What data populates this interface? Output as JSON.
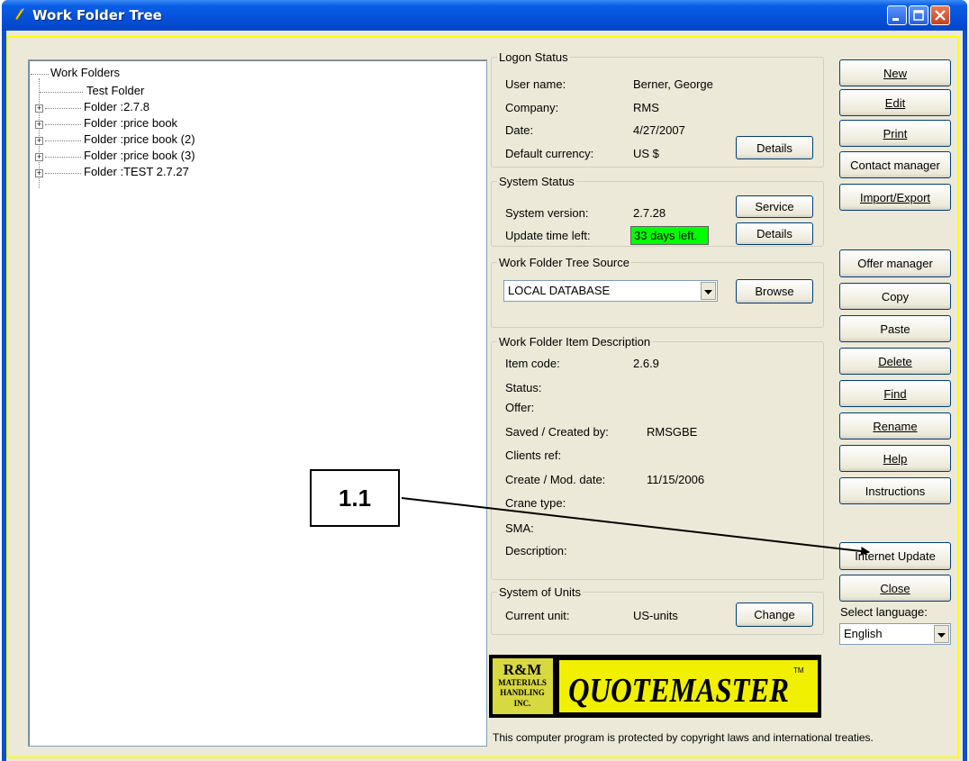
{
  "window": {
    "title": "Work Folder Tree"
  },
  "tree": {
    "root": "Work Folders",
    "items": [
      "Test Folder",
      "Folder :2.7.8",
      "Folder :price book",
      "Folder :price book (2)",
      "Folder :price book (3)",
      "Folder :TEST 2.7.27"
    ],
    "expandable": [
      false,
      true,
      true,
      true,
      true,
      true
    ]
  },
  "logon": {
    "legend": "Logon Status",
    "user_label": "User name:",
    "user_value": "Berner, George",
    "company_label": "Company:",
    "company_value": "RMS",
    "date_label": "Date:",
    "date_value": "4/27/2007",
    "currency_label": "Default currency:",
    "currency_value": "US $",
    "details_button": "Details"
  },
  "system": {
    "legend": "System Status",
    "version_label": "System version:",
    "version_value": "2.7.28",
    "update_label": "Update time left:",
    "update_value": "33 days left.",
    "service_button": "Service",
    "details_button": "Details"
  },
  "source": {
    "legend": "Work Folder Tree Source",
    "selected": "LOCAL DATABASE",
    "browse_button": "Browse"
  },
  "item": {
    "legend": "Work Folder Item Description",
    "code_label": "Item code:",
    "code_value": "2.6.9",
    "status_label": "Status:",
    "offer_label": "Offer:",
    "saved_label": "Saved / Created by:",
    "saved_value": "RMSGBE",
    "clients_label": "Clients ref:",
    "date_label": "Create / Mod. date:",
    "date_value": "11/15/2006",
    "crane_label": "Crane type:",
    "sma_label": "SMA:",
    "desc_label": "Description:"
  },
  "units": {
    "legend": "System of Units",
    "current_label": "Current unit:",
    "current_value": "US-units",
    "change_button": "Change"
  },
  "buttons": {
    "new": "New",
    "edit": "Edit",
    "print": "Print",
    "contact": "Contact manager",
    "import_export": "Import/Export",
    "offer": "Offer manager",
    "copy": "Copy",
    "paste": "Paste",
    "delete": "Delete",
    "find": "Find",
    "rename": "Rename",
    "help": "Help",
    "instructions": "Instructions",
    "internet_update": "Internet Update",
    "close": "Close"
  },
  "language": {
    "label": "Select language:",
    "selected": "English"
  },
  "logo": {
    "line1": "R&M",
    "line2": "MATERIALS",
    "line3": "HANDLING",
    "line4": "INC.",
    "product": "QUOTEMASTER",
    "tm": "TM"
  },
  "copyright": "This computer program is protected by copyright laws and international treaties.",
  "callout": {
    "label": "1.1"
  },
  "colors": {
    "titlebar": "#0450d8",
    "face": "#ece9d8",
    "frame": "#ffff00",
    "update_ok": "#00ff00",
    "logo_yellow": "#f0f000"
  }
}
